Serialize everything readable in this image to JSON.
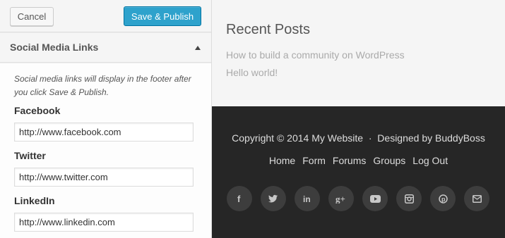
{
  "toolbar": {
    "cancel_label": "Cancel",
    "publish_label": "Save & Publish",
    "accent_color": "#2ea2cc"
  },
  "section": {
    "title": "Social Media Links",
    "description": "Social media links will display in the footer after you click Save & Publish.",
    "fields": [
      {
        "label": "Facebook",
        "value": "http://www.facebook.com"
      },
      {
        "label": "Twitter",
        "value": "http://www.twitter.com"
      },
      {
        "label": "LinkedIn",
        "value": "http://www.linkedin.com"
      }
    ]
  },
  "preview": {
    "widget_title": "Recent Posts",
    "posts": [
      "How to build a community on WordPress",
      "Hello world!"
    ],
    "footer": {
      "copyright": "Copyright © 2014 My Website  ·  Designed by BuddyBoss",
      "nav": [
        "Home",
        "Form",
        "Forums",
        "Groups",
        "Log Out"
      ],
      "social_icons": [
        "facebook-icon",
        "twitter-icon",
        "linkedin-icon",
        "google-plus-icon",
        "youtube-icon",
        "instagram-icon",
        "pinterest-icon",
        "email-icon"
      ],
      "background_color": "#262626"
    }
  }
}
